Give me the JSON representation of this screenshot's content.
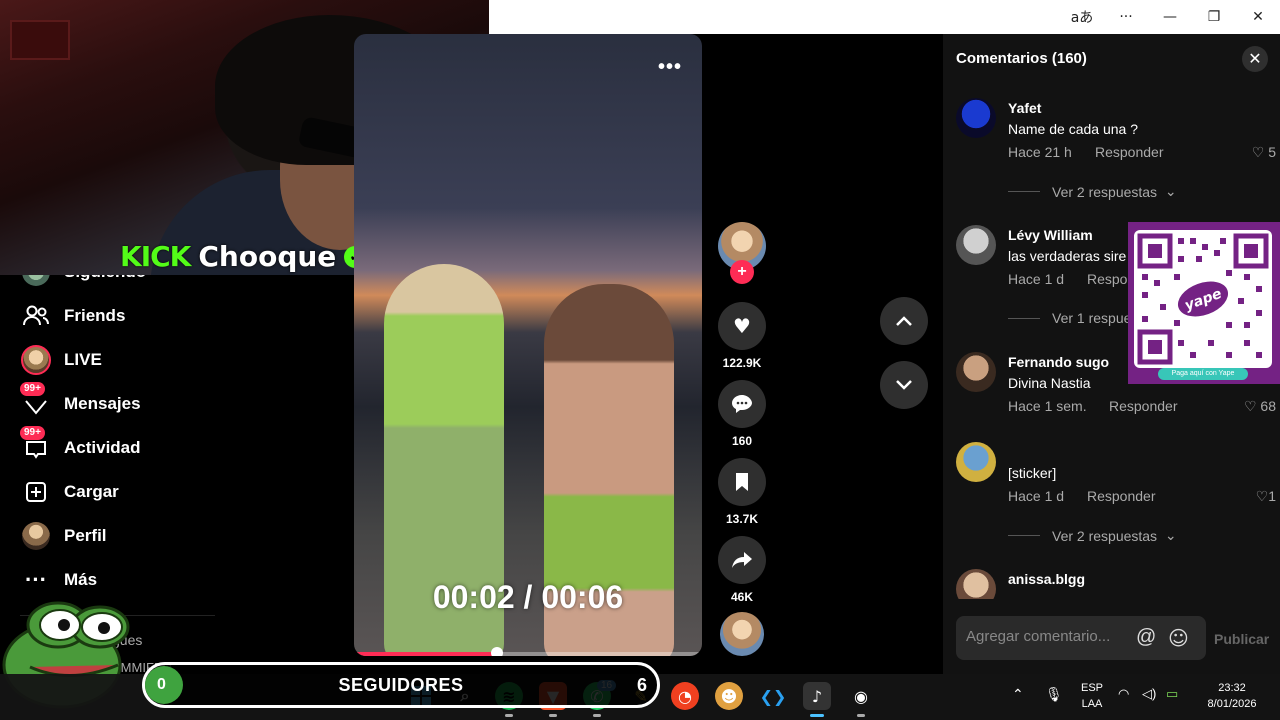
{
  "titlebar": {
    "translate_icon": "translate-icon",
    "more": "···",
    "minimize": "—",
    "restore": "❐",
    "close": "✕"
  },
  "webcam": {
    "kick_logo": "KICK",
    "channel": "Chooque",
    "verified": "✓"
  },
  "sidebar": {
    "items": [
      {
        "label": "Siguiendo",
        "icon": "avatar-icon"
      },
      {
        "label": "Friends",
        "icon": "friends-icon"
      },
      {
        "label": "LIVE",
        "icon": "live-avatar-icon"
      },
      {
        "label": "Mensajes",
        "icon": "inbox-icon",
        "badge": "99+"
      },
      {
        "label": "Actividad",
        "icon": "activity-icon",
        "badge": "99+"
      },
      {
        "label": "Cargar",
        "icon": "upload-icon"
      },
      {
        "label": "Perfil",
        "icon": "profile-avatar-icon"
      },
      {
        "label": "Más",
        "icon": "more-icon"
      }
    ],
    "partial_1": "gues",
    "partial_2": "SMMIFER"
  },
  "video": {
    "more": "•••",
    "timecode": "00:02 / 00:06",
    "progress": 0.41
  },
  "actions": {
    "likes": "122.9K",
    "comments": "160",
    "saves": "13.7K",
    "shares": "46K",
    "follow_plus": "+"
  },
  "comments": {
    "title": "Comentarios (160)",
    "close": "✕",
    "items": [
      {
        "user": "Yafet",
        "text": "Name de cada una ?",
        "time": "Hace 21 h",
        "reply": "Responder",
        "likes": "5",
        "more": "Ver 2 respuestas"
      },
      {
        "user": "Lévy William",
        "text": "las verdaderas sire",
        "time": "Hace 1 d",
        "reply": "Respo",
        "likes": "",
        "more": "Ver 1 respue"
      },
      {
        "user": "Fernando sugo",
        "text": "Divina Nastia",
        "time": "Hace 1 sem.",
        "reply": "Responder",
        "likes": "68",
        "more": ""
      },
      {
        "user": "[sticker]",
        "text": "",
        "time": "Hace 1 d",
        "reply": "Responder",
        "likes": "1",
        "more": "Ver 2 respuestas"
      },
      {
        "user": "anissa.blgg",
        "text": "",
        "time": "",
        "reply": "",
        "likes": "",
        "more": ""
      }
    ],
    "placeholder": "Agregar comentario...",
    "at": "@",
    "post": "Publicar"
  },
  "qr": {
    "label": "Paga aquí con Yape",
    "brand": "yape"
  },
  "followers": {
    "count": "0",
    "label": "SEGUIDORES",
    "right": "6"
  },
  "taskbar": {
    "whatsapp_badge": "16",
    "lang": "ESP",
    "lang2": "LAA",
    "time": "23:32",
    "date": "8/01/2026"
  },
  "colors": {
    "tiktok_red": "#fe2c55",
    "kick_green": "#53fc18",
    "yape_purple": "#742284"
  }
}
